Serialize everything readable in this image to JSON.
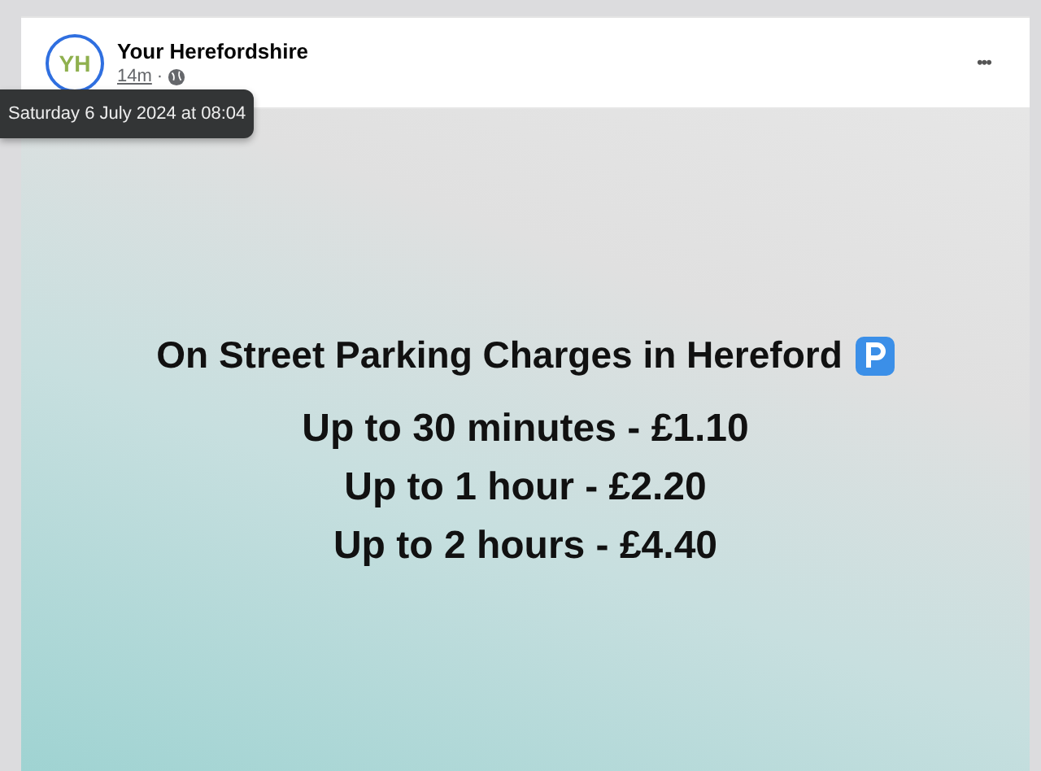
{
  "post": {
    "author": "Your Herefordshire",
    "avatar_initials": "YH",
    "time": "14m",
    "separator": "·",
    "tooltip": "Saturday 6 July 2024 at 08:04",
    "more": "•••"
  },
  "image": {
    "heading": "On Street Parking Charges in Hereford",
    "lines": [
      "Up to 30 minutes - £1.10",
      "Up to 1 hour - £2.20",
      "Up to 2 hours - £4.40"
    ]
  }
}
